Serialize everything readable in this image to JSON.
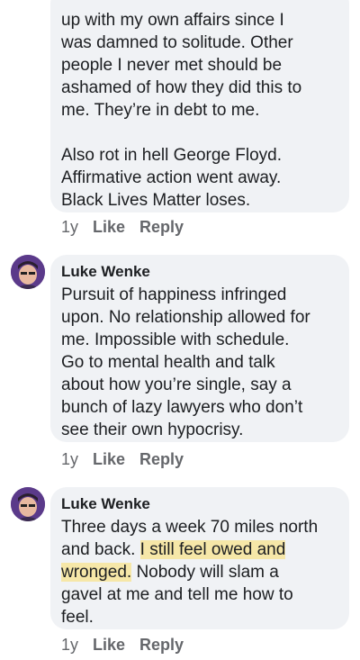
{
  "comments": [
    {
      "text": "up with my own affairs since I\nwas damned to solitude.  Other\npeople I never met should be\nashamed of how they did this to\nme.  They’re in debt to me.\n\nAlso rot in hell George Floyd.\nAffirmative action went away.\nBlack Lives Matter loses.",
      "time": "1y",
      "like": "Like",
      "reply": "Reply"
    },
    {
      "author": "Luke Wenke",
      "text": "Pursuit of happiness infringed\nupon.  No relationship allowed for\nme.  Impossible with schedule.\nGo to mental health and talk\nabout how you’re single, say a\nbunch of lazy lawyers who don’t\nsee their own hypocrisy.",
      "time": "1y",
      "like": "Like",
      "reply": "Reply"
    },
    {
      "author": "Luke Wenke",
      "text_parts": [
        "Three days a week 70 miles north\nand back.  ",
        "I still feel owed and\nwronged.",
        "  Nobody will slam a\ngavel at me and tell me how to\nfeel."
      ],
      "time": "1y",
      "like": "Like",
      "reply": "Reply"
    }
  ]
}
